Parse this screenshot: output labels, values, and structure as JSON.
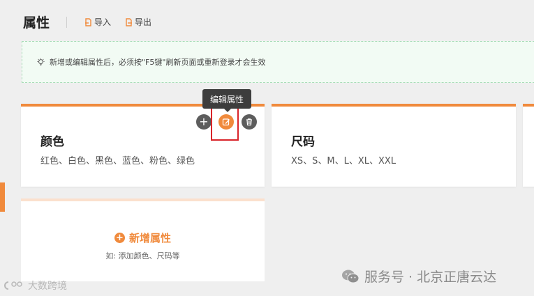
{
  "header": {
    "title": "属性",
    "import_label": "导入",
    "export_label": "导出"
  },
  "notice": {
    "text": "新增或编辑属性后，必须按\"F5键\"刷新页面或重新登录才会生效"
  },
  "tooltip": {
    "text": "编辑属性"
  },
  "attributes": [
    {
      "name": "颜色",
      "values": "红色、白色、黑色、蓝色、粉色、绿色"
    },
    {
      "name": "尺码",
      "values": "XS、S、M、L、XL、XXL"
    }
  ],
  "add_card": {
    "icon_glyph": "+",
    "label": "新增属性",
    "hint": "如: 添加颜色、尺码等"
  },
  "card_actions": {
    "add_glyph": "+"
  },
  "watermarks": {
    "right": "服务号 · 北京正唐云达",
    "left": "大数跨境"
  },
  "colors": {
    "accent": "#f08a3c",
    "highlight": "#d9242a",
    "notice_bg": "#f2fbf4",
    "notice_border": "#a9ddb8"
  }
}
